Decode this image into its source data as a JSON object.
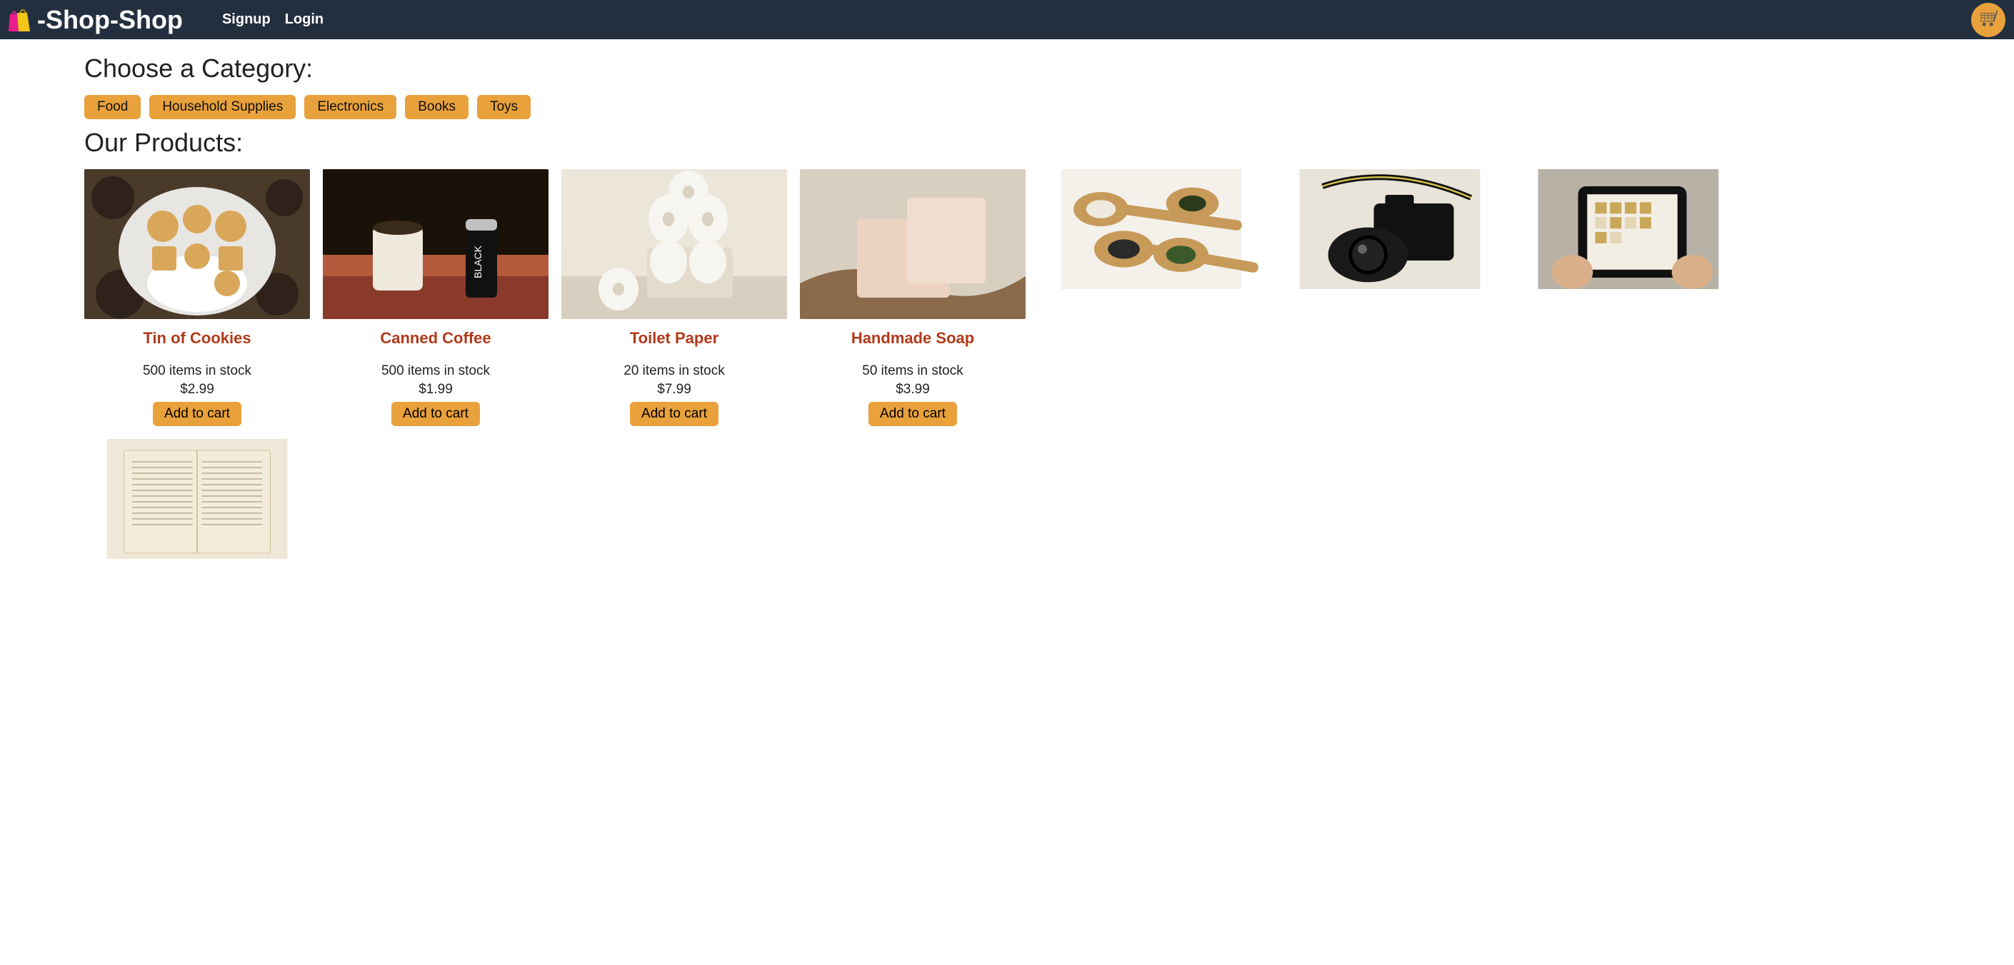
{
  "header": {
    "brand": "-Shop-Shop",
    "nav": {
      "signup": "Signup",
      "login": "Login"
    }
  },
  "colors": {
    "accent": "#e9a13b",
    "brandLink": "#b03a1a",
    "navBg": "#232f3e"
  },
  "categorySection": {
    "title": "Choose a Category:",
    "items": [
      {
        "label": "Food"
      },
      {
        "label": "Household Supplies"
      },
      {
        "label": "Electronics"
      },
      {
        "label": "Books"
      },
      {
        "label": "Toys"
      }
    ]
  },
  "productsSection": {
    "title": "Our Products:",
    "addLabel": "Add to cart",
    "items": [
      {
        "name": "Tin of Cookies",
        "stock": "500 items in stock",
        "price": "$2.99",
        "image": "cookies"
      },
      {
        "name": "Canned Coffee",
        "stock": "500 items in stock",
        "price": "$1.99",
        "image": "coffee"
      },
      {
        "name": "Toilet Paper",
        "stock": "20 items in stock",
        "price": "$7.99",
        "image": "toilet-paper"
      },
      {
        "name": "Handmade Soap",
        "stock": "50 items in stock",
        "price": "$3.99",
        "image": "soap"
      },
      {
        "name": "",
        "stock": "",
        "price": "",
        "image": "spices",
        "partial": true
      },
      {
        "name": "",
        "stock": "",
        "price": "",
        "image": "camera",
        "partial": true
      },
      {
        "name": "",
        "stock": "",
        "price": "",
        "image": "tablet",
        "partial": true
      },
      {
        "name": "",
        "stock": "",
        "price": "",
        "image": "book",
        "partial": true
      }
    ]
  }
}
